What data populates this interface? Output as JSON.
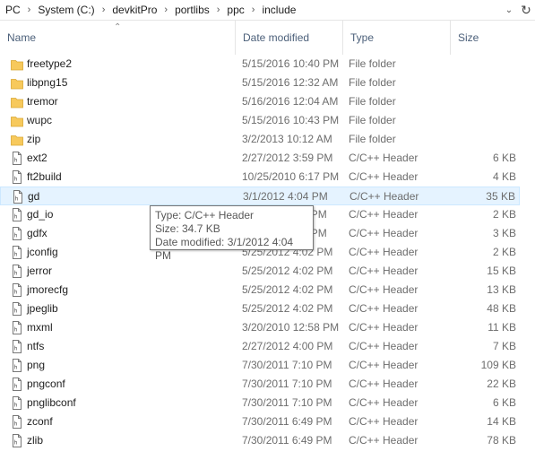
{
  "breadcrumb": [
    "PC",
    "System (C:)",
    "devkitPro",
    "portlibs",
    "ppc",
    "include"
  ],
  "columns": {
    "name": "Name",
    "date": "Date modified",
    "type": "Type",
    "size": "Size"
  },
  "files": [
    {
      "name": "freetype2",
      "date": "5/15/2016 10:40 PM",
      "type": "File folder",
      "size": "",
      "kind": "folder"
    },
    {
      "name": "libpng15",
      "date": "5/15/2016 12:32 AM",
      "type": "File folder",
      "size": "",
      "kind": "folder"
    },
    {
      "name": "tremor",
      "date": "5/16/2016 12:04 AM",
      "type": "File folder",
      "size": "",
      "kind": "folder"
    },
    {
      "name": "wupc",
      "date": "5/15/2016 10:43 PM",
      "type": "File folder",
      "size": "",
      "kind": "folder"
    },
    {
      "name": "zip",
      "date": "3/2/2013 10:12 AM",
      "type": "File folder",
      "size": "",
      "kind": "folder"
    },
    {
      "name": "ext2",
      "date": "2/27/2012 3:59 PM",
      "type": "C/C++ Header",
      "size": "6 KB",
      "kind": "header"
    },
    {
      "name": "ft2build",
      "date": "10/25/2010 6:17 PM",
      "type": "C/C++ Header",
      "size": "4 KB",
      "kind": "header"
    },
    {
      "name": "gd",
      "date": "3/1/2012 4:04 PM",
      "type": "C/C++ Header",
      "size": "35 KB",
      "kind": "header"
    },
    {
      "name": "gd_io",
      "date": "3/1/2012 4:04 PM",
      "type": "C/C++ Header",
      "size": "2 KB",
      "kind": "header"
    },
    {
      "name": "gdfx",
      "date": "3/1/2012 4:04 PM",
      "type": "C/C++ Header",
      "size": "3 KB",
      "kind": "header"
    },
    {
      "name": "jconfig",
      "date": "5/25/2012 4:02 PM",
      "type": "C/C++ Header",
      "size": "2 KB",
      "kind": "header"
    },
    {
      "name": "jerror",
      "date": "5/25/2012 4:02 PM",
      "type": "C/C++ Header",
      "size": "15 KB",
      "kind": "header"
    },
    {
      "name": "jmorecfg",
      "date": "5/25/2012 4:02 PM",
      "type": "C/C++ Header",
      "size": "13 KB",
      "kind": "header"
    },
    {
      "name": "jpeglib",
      "date": "5/25/2012 4:02 PM",
      "type": "C/C++ Header",
      "size": "48 KB",
      "kind": "header"
    },
    {
      "name": "mxml",
      "date": "3/20/2010 12:58 PM",
      "type": "C/C++ Header",
      "size": "11 KB",
      "kind": "header"
    },
    {
      "name": "ntfs",
      "date": "2/27/2012 4:00 PM",
      "type": "C/C++ Header",
      "size": "7 KB",
      "kind": "header"
    },
    {
      "name": "png",
      "date": "7/30/2011 7:10 PM",
      "type": "C/C++ Header",
      "size": "109 KB",
      "kind": "header"
    },
    {
      "name": "pngconf",
      "date": "7/30/2011 7:10 PM",
      "type": "C/C++ Header",
      "size": "22 KB",
      "kind": "header"
    },
    {
      "name": "pnglibconf",
      "date": "7/30/2011 7:10 PM",
      "type": "C/C++ Header",
      "size": "6 KB",
      "kind": "header"
    },
    {
      "name": "zconf",
      "date": "7/30/2011 6:49 PM",
      "type": "C/C++ Header",
      "size": "14 KB",
      "kind": "header"
    },
    {
      "name": "zlib",
      "date": "7/30/2011 6:49 PM",
      "type": "C/C++ Header",
      "size": "78 KB",
      "kind": "header"
    }
  ],
  "hovered_index": 7,
  "tooltip": {
    "type": "Type: C/C++ Header",
    "size": "Size: 34.7 KB",
    "date": "Date modified: 3/1/2012 4:04 PM"
  },
  "colors": {
    "folder": "#f7c95c",
    "hover_bg": "#e5f3ff",
    "header_text": "#4c607a"
  }
}
